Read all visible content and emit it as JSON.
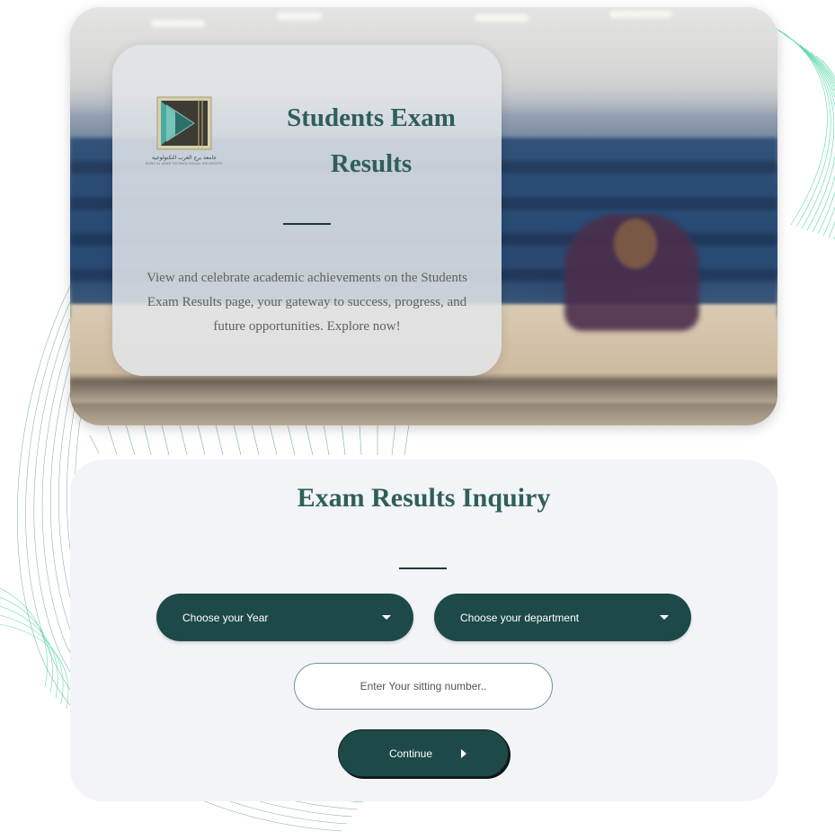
{
  "hero": {
    "title": "Students Exam Results",
    "description": "View and celebrate academic achievements on the Students Exam Results page, your gateway to success, progress, and future opportunities. Explore now!",
    "logo_caption_ar": "جامعة برج العرب التكنولوجية",
    "logo_caption_en": "BORG AL ARAB TECHNOLOGICAL UNIVERSITY"
  },
  "inquiry": {
    "title": "Exam Results Inquiry",
    "year_select": {
      "label": "Choose your Year"
    },
    "department_select": {
      "label": "Choose your department"
    },
    "sitting_number": {
      "placeholder": "Enter Your sitting number..",
      "value": ""
    },
    "continue_label": "Continue"
  },
  "icons": {
    "dropdown": "caret-down-icon",
    "continue": "caret-right-icon",
    "logo": "university-logo"
  },
  "colors": {
    "accent_dark": "#1d4a48",
    "title_teal": "#2f5f5a",
    "card_bg": "#f3f4f8",
    "deco_green": "#1fd08a"
  }
}
